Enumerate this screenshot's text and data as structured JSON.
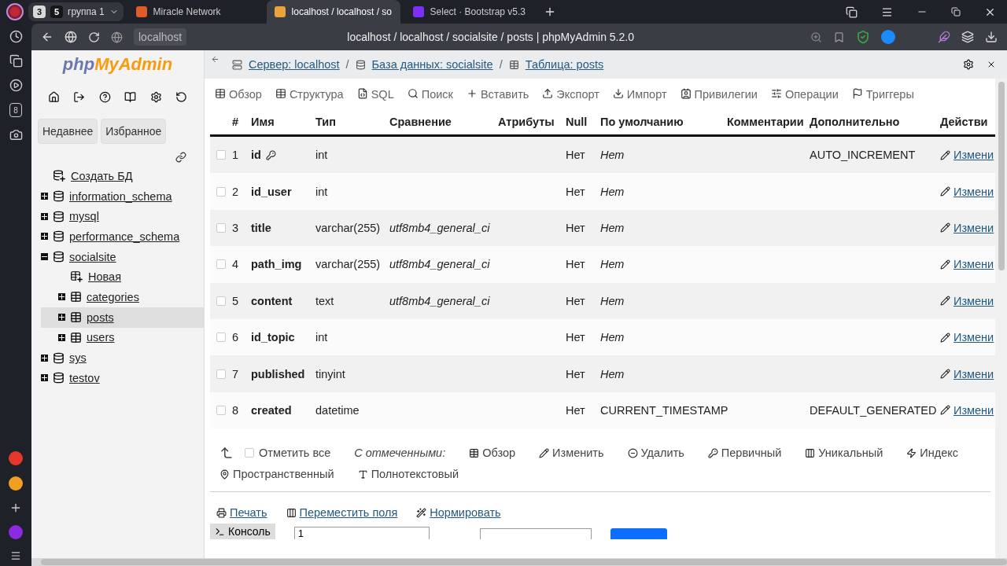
{
  "browser": {
    "group_count": "3",
    "group": {
      "count": "5",
      "label": "группа 1"
    },
    "tabs": [
      {
        "title": "Miracle Network",
        "kind": "miracle",
        "selected": false
      },
      {
        "title": "localhost / localhost / so",
        "kind": "pma",
        "selected": true
      },
      {
        "title": "Select · Bootstrap v5.3",
        "kind": "bootstrap",
        "selected": false
      }
    ],
    "address": "localhost",
    "page_title": "localhost / localhost / socialsite / posts | phpMyAdmin 5.2.0",
    "rail_badge": "8"
  },
  "navigation": {
    "logo": {
      "first": "php",
      "second": "MyAdmin"
    },
    "buttons": [
      "Недавнее",
      "Избранное"
    ],
    "tree": [
      {
        "label": "Создать БД",
        "kind": "new-db"
      },
      {
        "label": "information_schema",
        "kind": "db",
        "expanded": false,
        "selected": false
      },
      {
        "label": "mysql",
        "kind": "db",
        "expanded": false,
        "selected": false
      },
      {
        "label": "performance_schema",
        "kind": "db",
        "expanded": false,
        "selected": false
      },
      {
        "label": "socialsite",
        "kind": "db",
        "expanded": true,
        "selected": false,
        "children": [
          {
            "label": "Новая",
            "kind": "new-table"
          },
          {
            "label": "categories",
            "kind": "table",
            "expanded": false,
            "selected": false
          },
          {
            "label": "posts",
            "kind": "table",
            "expanded": false,
            "selected": true
          },
          {
            "label": "users",
            "kind": "table",
            "expanded": false,
            "selected": false
          }
        ]
      },
      {
        "label": "sys",
        "kind": "db",
        "expanded": false,
        "selected": false
      },
      {
        "label": "testov",
        "kind": "db",
        "expanded": false,
        "selected": false
      }
    ]
  },
  "breadcrumb": [
    {
      "label": "Сервер: localhost",
      "kind": "server"
    },
    {
      "separator": "/",
      "label": "База данных: socialsite",
      "kind": "db"
    },
    {
      "separator": "/",
      "label": "Таблица: posts",
      "kind": "table"
    }
  ],
  "tabs": [
    {
      "label": "Обзор",
      "kind": "browse"
    },
    {
      "label": "Структура",
      "kind": "structure"
    },
    {
      "label": "SQL",
      "kind": "sql"
    },
    {
      "label": "Поиск",
      "kind": "search"
    },
    {
      "label": "Вставить",
      "kind": "insert"
    },
    {
      "label": "Экспорт",
      "kind": "export"
    },
    {
      "label": "Импорт",
      "kind": "import"
    },
    {
      "label": "Привилегии",
      "kind": "privileges"
    },
    {
      "label": "Операции",
      "kind": "operations"
    },
    {
      "label": "Триггеры",
      "kind": "triggers"
    }
  ],
  "table": {
    "columns": [
      "#",
      "Имя",
      "Тип",
      "Сравнение",
      "Атрибуты",
      "Null",
      "По умолчанию",
      "Комментарии",
      "Дополнительно",
      "Действи"
    ],
    "rows": [
      {
        "checked": false,
        "num": "1",
        "name": "id",
        "primary": true,
        "type": "int",
        "null": "Нет",
        "default": {
          "text": "Нет",
          "italic": true
        },
        "extra": "AUTO_INCREMENT",
        "action": "Измени"
      },
      {
        "checked": false,
        "num": "2",
        "name": "id_user",
        "primary": false,
        "type": "int",
        "null": "Нет",
        "default": {
          "text": "Нет",
          "italic": true
        },
        "action": "Измени"
      },
      {
        "checked": false,
        "num": "3",
        "name": "title",
        "primary": false,
        "type": "varchar(255)",
        "collation": "utf8mb4_general_ci",
        "null": "Нет",
        "default": {
          "text": "Нет",
          "italic": true
        },
        "action": "Измени"
      },
      {
        "checked": false,
        "num": "4",
        "name": "path_img",
        "primary": false,
        "type": "varchar(255)",
        "collation": "utf8mb4_general_ci",
        "null": "Нет",
        "default": {
          "text": "Нет",
          "italic": true
        },
        "action": "Измени"
      },
      {
        "checked": false,
        "num": "5",
        "name": "content",
        "primary": false,
        "type": "text",
        "collation": "utf8mb4_general_ci",
        "null": "Нет",
        "default": {
          "text": "Нет",
          "italic": true
        },
        "action": "Измени"
      },
      {
        "checked": false,
        "num": "6",
        "name": "id_topic",
        "primary": false,
        "type": "int",
        "null": "Нет",
        "default": {
          "text": "Нет",
          "italic": true
        },
        "action": "Измени"
      },
      {
        "checked": false,
        "num": "7",
        "name": "published",
        "primary": false,
        "type": "tinyint",
        "null": "Нет",
        "default": {
          "text": "Нет",
          "italic": true
        },
        "action": "Измени"
      },
      {
        "checked": false,
        "num": "8",
        "name": "created",
        "primary": false,
        "type": "datetime",
        "null": "Нет",
        "default": {
          "text": "CURRENT_TIMESTAMP",
          "italic": false
        },
        "extra": "DEFAULT_GENERATED",
        "action": "Измени"
      }
    ]
  },
  "bulk": {
    "check_all": {
      "label": "Отметить все",
      "checked": false
    },
    "with_selected": "С отмеченными:",
    "actions": [
      {
        "label": "Обзор",
        "kind": "browse"
      },
      {
        "label": "Изменить",
        "kind": "change"
      },
      {
        "label": "Удалить",
        "kind": "drop"
      },
      {
        "label": "Первичный",
        "kind": "primary"
      },
      {
        "label": "Уникальный",
        "kind": "unique"
      },
      {
        "label": "Индекс",
        "kind": "index"
      },
      {
        "label": "Пространственный",
        "kind": "spatial"
      },
      {
        "label": "Полнотекстовый",
        "kind": "fulltext"
      }
    ]
  },
  "links": [
    {
      "label": "Печать",
      "kind": "print"
    },
    {
      "label": "Переместить поля",
      "kind": "move"
    },
    {
      "label": "Нормировать",
      "kind": "normalize"
    }
  ],
  "console": "Консоль",
  "add_field": {
    "value": "1"
  }
}
